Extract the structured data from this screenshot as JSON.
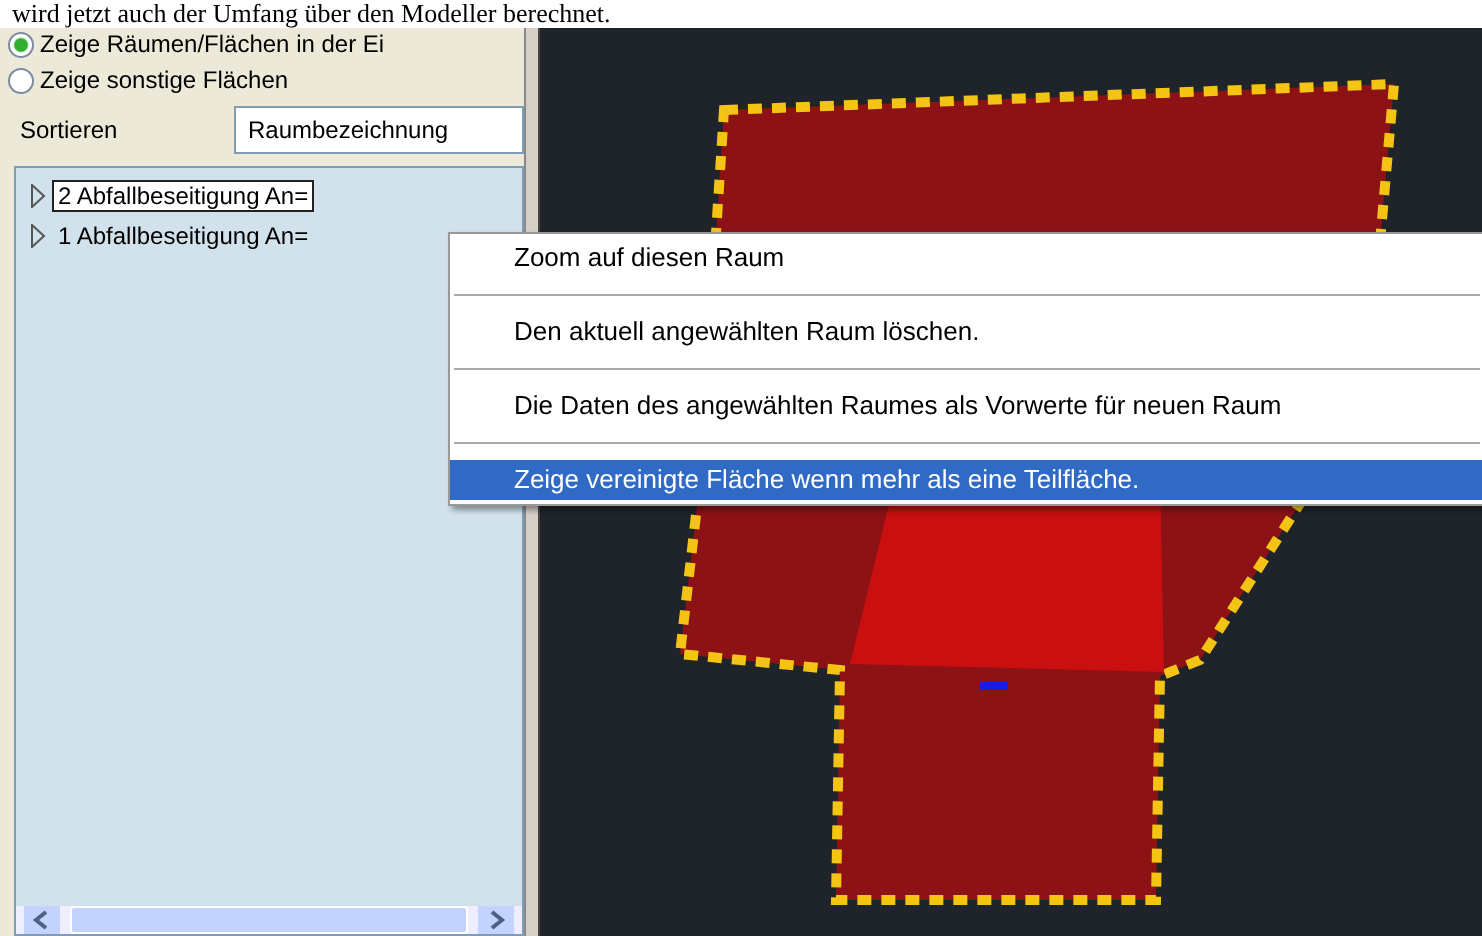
{
  "caption": "wird jetzt auch der Umfang  über den Modeller berechnet.",
  "radios": [
    {
      "label": "Zeige Räumen/Flächen in der Ei",
      "selected": true
    },
    {
      "label": "Zeige sonstige  Flächen",
      "selected": false
    }
  ],
  "sort": {
    "label": "Sortieren",
    "value": "Raumbezeichnung"
  },
  "tree": [
    {
      "label": "2 Abfallbeseitigung An=",
      "selected": true,
      "expanded": false
    },
    {
      "label": "1 Abfallbeseitigung An=",
      "selected": false,
      "expanded": false
    }
  ],
  "context_menu": [
    {
      "label": "Zoom auf diesen Raum",
      "selected": false
    },
    {
      "label": "Den aktuell angewählten Raum löschen.",
      "selected": false
    },
    {
      "label": "Die Daten des angewählten Raumes als Vorwerte für neuen Raum",
      "selected": false
    },
    {
      "label": "Zeige vereinigte Fläche wenn mehr als eine Teilfläche.",
      "selected": true
    }
  ]
}
